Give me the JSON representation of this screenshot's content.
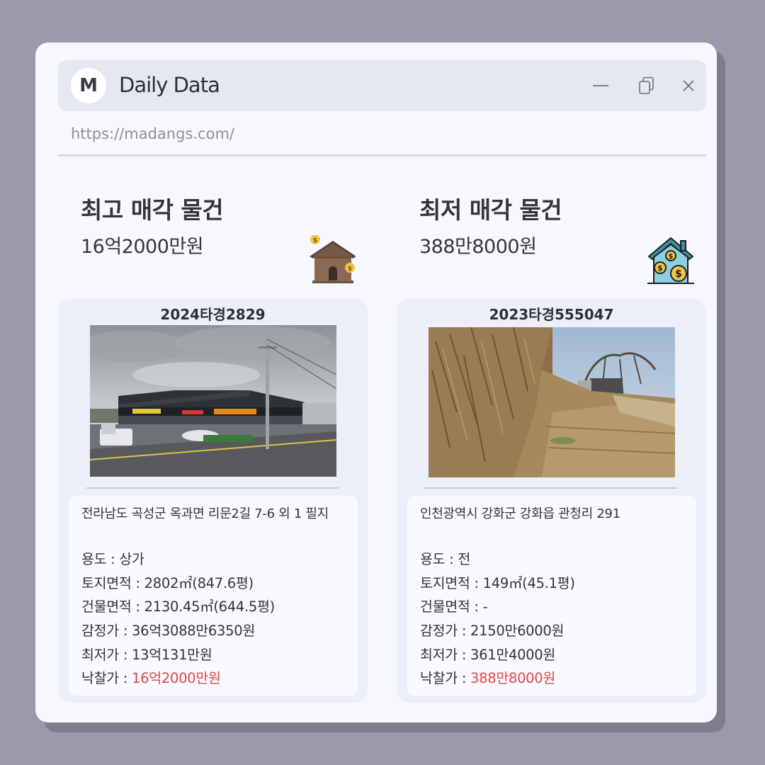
{
  "window": {
    "logo_letter": "M",
    "title": "Daily Data",
    "url": "https://madangs.com/"
  },
  "highest": {
    "heading": "최고 매각 물건",
    "price": "16억2000만원",
    "case_no": "2024타경2829",
    "address": "전라남도 곡성군 옥과면 리문2길 7-6 외 1 필지",
    "usage_label": "용도 : ",
    "usage": "상가",
    "land_label": "토지면적 : ",
    "land_area": "2802㎡(847.6평)",
    "building_label": "건물면적 : ",
    "building_area": "2130.45㎡(644.5평)",
    "appraisal_label": "감정가 : ",
    "appraisal": "36억3088만6350원",
    "minimum_label": "최저가 : ",
    "minimum": "13억131만원",
    "winning_label": "낙찰가 : ",
    "winning": "16억2000만원"
  },
  "lowest": {
    "heading": "최저 매각 물건",
    "price": "388만8000원",
    "case_no": "2023타경555047",
    "address": "인천광역시 강화군 강화읍 관청리 291",
    "usage_label": "용도 : ",
    "usage": "전",
    "land_label": "토지면적 : ",
    "land_area": "149㎡(45.1평)",
    "building_label": "건물면적 : ",
    "building_area": "-",
    "appraisal_label": "감정가 : ",
    "appraisal": "2150만6000원",
    "minimum_label": "최저가 : ",
    "minimum": "361만4000원",
    "winning_label": "낙찰가 : ",
    "winning": "388만8000원"
  },
  "icons": {
    "minimize": "minimize-icon",
    "copy": "copy-icon",
    "close": "close-icon",
    "highest_house": "house-dollar-icon",
    "lowest_house": "house-coins-icon"
  },
  "colors": {
    "accent_red": "#e04545",
    "background": "#9a9aab",
    "window": "#f7f8fe",
    "card": "#eceffa"
  }
}
